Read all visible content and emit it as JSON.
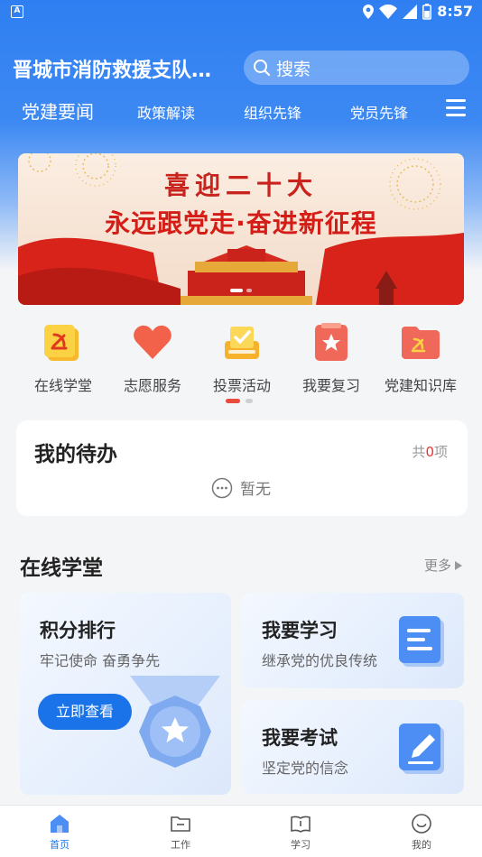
{
  "status_bar": {
    "time": "8:57",
    "indicator": "A"
  },
  "header": {
    "org_name": "晋城市消防救援支队…",
    "search_placeholder": "搜索"
  },
  "nav": {
    "tabs": [
      "党建要闻",
      "政策解读",
      "组织先锋",
      "党员先锋"
    ],
    "active_index": 0
  },
  "banner": {
    "line1": "喜迎二十大",
    "line2": "永远跟党走·奋进新征程"
  },
  "shortcuts": [
    {
      "label": "在线学堂",
      "icon": "online-class-icon"
    },
    {
      "label": "志愿服务",
      "icon": "heart-icon"
    },
    {
      "label": "投票活动",
      "icon": "vote-icon"
    },
    {
      "label": "我要复习",
      "icon": "review-star-icon"
    },
    {
      "label": "党建知识库",
      "icon": "knowledge-folder-icon"
    }
  ],
  "todo": {
    "title": "我的待办",
    "count_prefix": "共",
    "count": "0",
    "count_suffix": "项",
    "empty_text": "暂无"
  },
  "section": {
    "title": "在线学堂",
    "more_label": "更多"
  },
  "cards": {
    "ranking": {
      "title": "积分排行",
      "subtitle": "牢记使命 奋勇争先",
      "button": "立即查看"
    },
    "study": {
      "title": "我要学习",
      "subtitle": "继承党的优良传统"
    },
    "exam": {
      "title": "我要考试",
      "subtitle": "坚定党的信念"
    }
  },
  "tabbar": [
    {
      "label": "首页",
      "active": true
    },
    {
      "label": "工作",
      "active": false
    },
    {
      "label": "学习",
      "active": false
    },
    {
      "label": "我的",
      "active": false
    }
  ],
  "colors": {
    "primary": "#1a73e8",
    "header_blue": "#2f7ff2",
    "party_red": "#d51d17",
    "badge_red": "#e33"
  }
}
